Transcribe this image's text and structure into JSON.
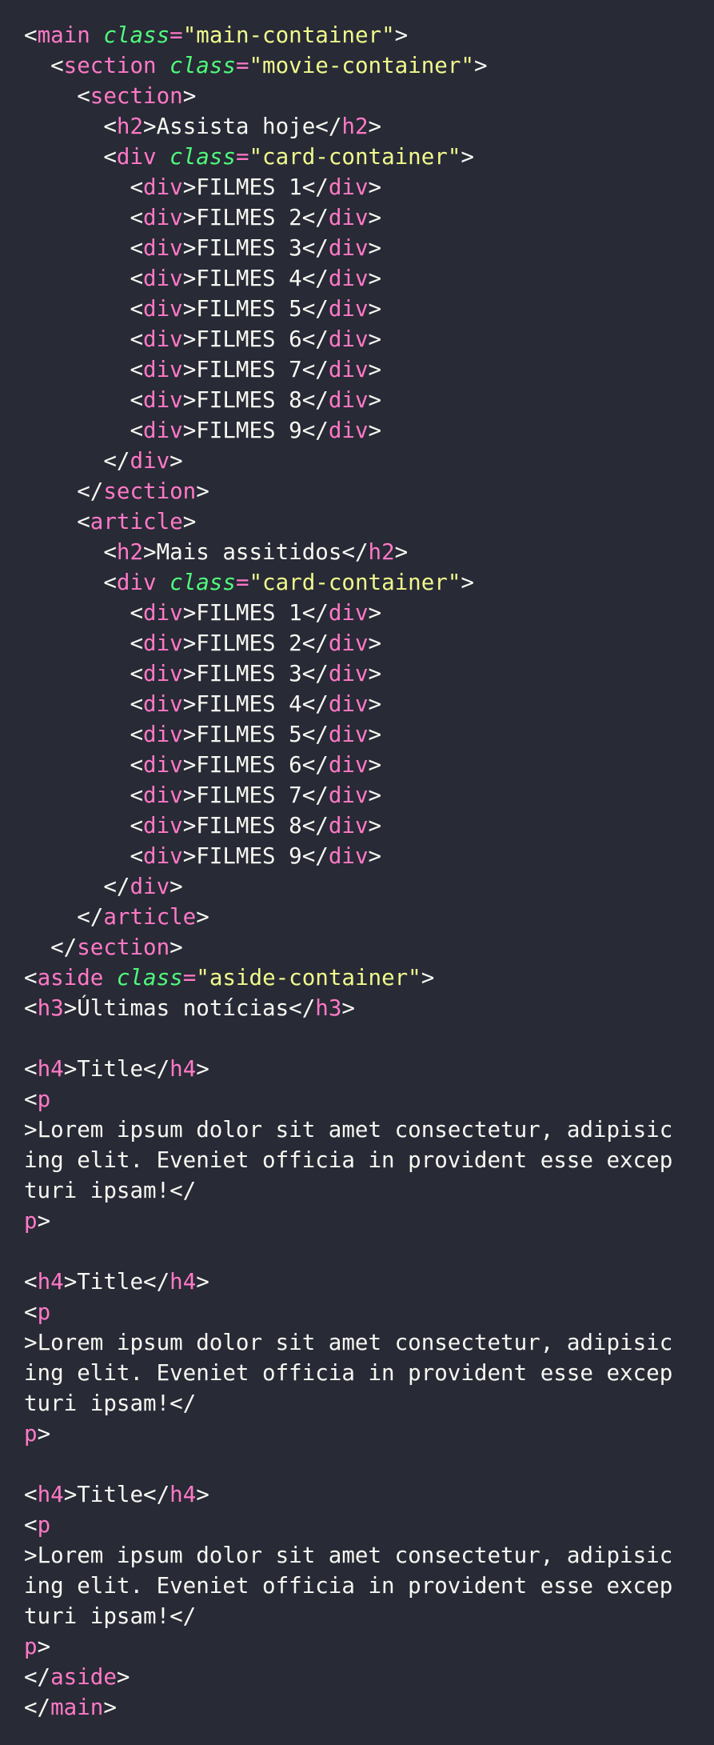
{
  "colors": {
    "background": "#282a36",
    "text": "#f8f8f2",
    "tag": "#ff79c6",
    "attribute": "#50fa7b",
    "string": "#f1fa8c"
  },
  "lines": [
    [
      [
        "p",
        "<"
      ],
      [
        "tag",
        "main"
      ],
      [
        "p",
        " "
      ],
      [
        "attr",
        "class"
      ],
      [
        "tag",
        "="
      ],
      [
        "str",
        "\"main-container\""
      ],
      [
        "p",
        ">"
      ]
    ],
    [
      [
        "p",
        "  <"
      ],
      [
        "tag",
        "section"
      ],
      [
        "p",
        " "
      ],
      [
        "attr",
        "class"
      ],
      [
        "tag",
        "="
      ],
      [
        "str",
        "\"movie-container\""
      ],
      [
        "p",
        ">"
      ]
    ],
    [
      [
        "p",
        "    <"
      ],
      [
        "tag",
        "section"
      ],
      [
        "p",
        ">"
      ]
    ],
    [
      [
        "p",
        "      <"
      ],
      [
        "tag",
        "h2"
      ],
      [
        "p",
        ">"
      ],
      [
        "text",
        "Assista hoje"
      ],
      [
        "p",
        "</"
      ],
      [
        "tag",
        "h2"
      ],
      [
        "p",
        ">"
      ]
    ],
    [
      [
        "p",
        "      <"
      ],
      [
        "tag",
        "div"
      ],
      [
        "p",
        " "
      ],
      [
        "attr",
        "class"
      ],
      [
        "tag",
        "="
      ],
      [
        "str",
        "\"card-container\""
      ],
      [
        "p",
        ">"
      ]
    ],
    [
      [
        "p",
        "        <"
      ],
      [
        "tag",
        "div"
      ],
      [
        "p",
        ">"
      ],
      [
        "text",
        "FILMES 1"
      ],
      [
        "p",
        "</"
      ],
      [
        "tag",
        "div"
      ],
      [
        "p",
        ">"
      ]
    ],
    [
      [
        "p",
        "        <"
      ],
      [
        "tag",
        "div"
      ],
      [
        "p",
        ">"
      ],
      [
        "text",
        "FILMES 2"
      ],
      [
        "p",
        "</"
      ],
      [
        "tag",
        "div"
      ],
      [
        "p",
        ">"
      ]
    ],
    [
      [
        "p",
        "        <"
      ],
      [
        "tag",
        "div"
      ],
      [
        "p",
        ">"
      ],
      [
        "text",
        "FILMES 3"
      ],
      [
        "p",
        "</"
      ],
      [
        "tag",
        "div"
      ],
      [
        "p",
        ">"
      ]
    ],
    [
      [
        "p",
        "        <"
      ],
      [
        "tag",
        "div"
      ],
      [
        "p",
        ">"
      ],
      [
        "text",
        "FILMES 4"
      ],
      [
        "p",
        "</"
      ],
      [
        "tag",
        "div"
      ],
      [
        "p",
        ">"
      ]
    ],
    [
      [
        "p",
        "        <"
      ],
      [
        "tag",
        "div"
      ],
      [
        "p",
        ">"
      ],
      [
        "text",
        "FILMES 5"
      ],
      [
        "p",
        "</"
      ],
      [
        "tag",
        "div"
      ],
      [
        "p",
        ">"
      ]
    ],
    [
      [
        "p",
        "        <"
      ],
      [
        "tag",
        "div"
      ],
      [
        "p",
        ">"
      ],
      [
        "text",
        "FILMES 6"
      ],
      [
        "p",
        "</"
      ],
      [
        "tag",
        "div"
      ],
      [
        "p",
        ">"
      ]
    ],
    [
      [
        "p",
        "        <"
      ],
      [
        "tag",
        "div"
      ],
      [
        "p",
        ">"
      ],
      [
        "text",
        "FILMES 7"
      ],
      [
        "p",
        "</"
      ],
      [
        "tag",
        "div"
      ],
      [
        "p",
        ">"
      ]
    ],
    [
      [
        "p",
        "        <"
      ],
      [
        "tag",
        "div"
      ],
      [
        "p",
        ">"
      ],
      [
        "text",
        "FILMES 8"
      ],
      [
        "p",
        "</"
      ],
      [
        "tag",
        "div"
      ],
      [
        "p",
        ">"
      ]
    ],
    [
      [
        "p",
        "        <"
      ],
      [
        "tag",
        "div"
      ],
      [
        "p",
        ">"
      ],
      [
        "text",
        "FILMES 9"
      ],
      [
        "p",
        "</"
      ],
      [
        "tag",
        "div"
      ],
      [
        "p",
        ">"
      ]
    ],
    [
      [
        "p",
        "      </"
      ],
      [
        "tag",
        "div"
      ],
      [
        "p",
        ">"
      ]
    ],
    [
      [
        "p",
        "    </"
      ],
      [
        "tag",
        "section"
      ],
      [
        "p",
        ">"
      ]
    ],
    [
      [
        "p",
        "    <"
      ],
      [
        "tag",
        "article"
      ],
      [
        "p",
        ">"
      ]
    ],
    [
      [
        "p",
        "      <"
      ],
      [
        "tag",
        "h2"
      ],
      [
        "p",
        ">"
      ],
      [
        "text",
        "Mais assitidos"
      ],
      [
        "p",
        "</"
      ],
      [
        "tag",
        "h2"
      ],
      [
        "p",
        ">"
      ]
    ],
    [
      [
        "p",
        "      <"
      ],
      [
        "tag",
        "div"
      ],
      [
        "p",
        " "
      ],
      [
        "attr",
        "class"
      ],
      [
        "tag",
        "="
      ],
      [
        "str",
        "\"card-container\""
      ],
      [
        "p",
        ">"
      ]
    ],
    [
      [
        "p",
        "        <"
      ],
      [
        "tag",
        "div"
      ],
      [
        "p",
        ">"
      ],
      [
        "text",
        "FILMES 1"
      ],
      [
        "p",
        "</"
      ],
      [
        "tag",
        "div"
      ],
      [
        "p",
        ">"
      ]
    ],
    [
      [
        "p",
        "        <"
      ],
      [
        "tag",
        "div"
      ],
      [
        "p",
        ">"
      ],
      [
        "text",
        "FILMES 2"
      ],
      [
        "p",
        "</"
      ],
      [
        "tag",
        "div"
      ],
      [
        "p",
        ">"
      ]
    ],
    [
      [
        "p",
        "        <"
      ],
      [
        "tag",
        "div"
      ],
      [
        "p",
        ">"
      ],
      [
        "text",
        "FILMES 3"
      ],
      [
        "p",
        "</"
      ],
      [
        "tag",
        "div"
      ],
      [
        "p",
        ">"
      ]
    ],
    [
      [
        "p",
        "        <"
      ],
      [
        "tag",
        "div"
      ],
      [
        "p",
        ">"
      ],
      [
        "text",
        "FILMES 4"
      ],
      [
        "p",
        "</"
      ],
      [
        "tag",
        "div"
      ],
      [
        "p",
        ">"
      ]
    ],
    [
      [
        "p",
        "        <"
      ],
      [
        "tag",
        "div"
      ],
      [
        "p",
        ">"
      ],
      [
        "text",
        "FILMES 5"
      ],
      [
        "p",
        "</"
      ],
      [
        "tag",
        "div"
      ],
      [
        "p",
        ">"
      ]
    ],
    [
      [
        "p",
        "        <"
      ],
      [
        "tag",
        "div"
      ],
      [
        "p",
        ">"
      ],
      [
        "text",
        "FILMES 6"
      ],
      [
        "p",
        "</"
      ],
      [
        "tag",
        "div"
      ],
      [
        "p",
        ">"
      ]
    ],
    [
      [
        "p",
        "        <"
      ],
      [
        "tag",
        "div"
      ],
      [
        "p",
        ">"
      ],
      [
        "text",
        "FILMES 7"
      ],
      [
        "p",
        "</"
      ],
      [
        "tag",
        "div"
      ],
      [
        "p",
        ">"
      ]
    ],
    [
      [
        "p",
        "        <"
      ],
      [
        "tag",
        "div"
      ],
      [
        "p",
        ">"
      ],
      [
        "text",
        "FILMES 8"
      ],
      [
        "p",
        "</"
      ],
      [
        "tag",
        "div"
      ],
      [
        "p",
        ">"
      ]
    ],
    [
      [
        "p",
        "        <"
      ],
      [
        "tag",
        "div"
      ],
      [
        "p",
        ">"
      ],
      [
        "text",
        "FILMES 9"
      ],
      [
        "p",
        "</"
      ],
      [
        "tag",
        "div"
      ],
      [
        "p",
        ">"
      ]
    ],
    [
      [
        "p",
        "      </"
      ],
      [
        "tag",
        "div"
      ],
      [
        "p",
        ">"
      ]
    ],
    [
      [
        "p",
        "    </"
      ],
      [
        "tag",
        "article"
      ],
      [
        "p",
        ">"
      ]
    ],
    [
      [
        "p",
        "  </"
      ],
      [
        "tag",
        "section"
      ],
      [
        "p",
        ">"
      ]
    ],
    [
      [
        "p",
        "<"
      ],
      [
        "tag",
        "aside"
      ],
      [
        "p",
        " "
      ],
      [
        "attr",
        "class"
      ],
      [
        "tag",
        "="
      ],
      [
        "str",
        "\"aside-container\""
      ],
      [
        "p",
        ">"
      ]
    ],
    [
      [
        "p",
        "<"
      ],
      [
        "tag",
        "h3"
      ],
      [
        "p",
        ">"
      ],
      [
        "text",
        "Últimas notícias"
      ],
      [
        "p",
        "</"
      ],
      [
        "tag",
        "h3"
      ],
      [
        "p",
        ">"
      ]
    ],
    [],
    [
      [
        "p",
        "<"
      ],
      [
        "tag",
        "h4"
      ],
      [
        "p",
        ">"
      ],
      [
        "text",
        "Title"
      ],
      [
        "p",
        "</"
      ],
      [
        "tag",
        "h4"
      ],
      [
        "p",
        ">"
      ]
    ],
    [
      [
        "p",
        "<"
      ],
      [
        "tag",
        "p"
      ]
    ],
    [
      [
        "p",
        ">"
      ],
      [
        "text",
        "Lorem ipsum dolor sit amet consectetur, adipisic"
      ]
    ],
    [
      [
        "text",
        "ing elit. Eveniet officia in provident esse excep"
      ]
    ],
    [
      [
        "text",
        "turi ipsam!"
      ],
      [
        "p",
        "</"
      ]
    ],
    [
      [
        "tag",
        "p"
      ],
      [
        "p",
        ">"
      ]
    ],
    [],
    [
      [
        "p",
        "<"
      ],
      [
        "tag",
        "h4"
      ],
      [
        "p",
        ">"
      ],
      [
        "text",
        "Title"
      ],
      [
        "p",
        "</"
      ],
      [
        "tag",
        "h4"
      ],
      [
        "p",
        ">"
      ]
    ],
    [
      [
        "p",
        "<"
      ],
      [
        "tag",
        "p"
      ]
    ],
    [
      [
        "p",
        ">"
      ],
      [
        "text",
        "Lorem ipsum dolor sit amet consectetur, adipisic"
      ]
    ],
    [
      [
        "text",
        "ing elit. Eveniet officia in provident esse excep"
      ]
    ],
    [
      [
        "text",
        "turi ipsam!"
      ],
      [
        "p",
        "</"
      ]
    ],
    [
      [
        "tag",
        "p"
      ],
      [
        "p",
        ">"
      ]
    ],
    [],
    [
      [
        "p",
        "<"
      ],
      [
        "tag",
        "h4"
      ],
      [
        "p",
        ">"
      ],
      [
        "text",
        "Title"
      ],
      [
        "p",
        "</"
      ],
      [
        "tag",
        "h4"
      ],
      [
        "p",
        ">"
      ]
    ],
    [
      [
        "p",
        "<"
      ],
      [
        "tag",
        "p"
      ]
    ],
    [
      [
        "p",
        ">"
      ],
      [
        "text",
        "Lorem ipsum dolor sit amet consectetur, adipisic"
      ]
    ],
    [
      [
        "text",
        "ing elit. Eveniet officia in provident esse excep"
      ]
    ],
    [
      [
        "text",
        "turi ipsam!"
      ],
      [
        "p",
        "</"
      ]
    ],
    [
      [
        "tag",
        "p"
      ],
      [
        "p",
        ">"
      ]
    ],
    [
      [
        "p",
        "</"
      ],
      [
        "tag",
        "aside"
      ],
      [
        "p",
        ">"
      ]
    ],
    [
      [
        "p",
        "</"
      ],
      [
        "tag",
        "main"
      ],
      [
        "p",
        ">"
      ]
    ]
  ]
}
